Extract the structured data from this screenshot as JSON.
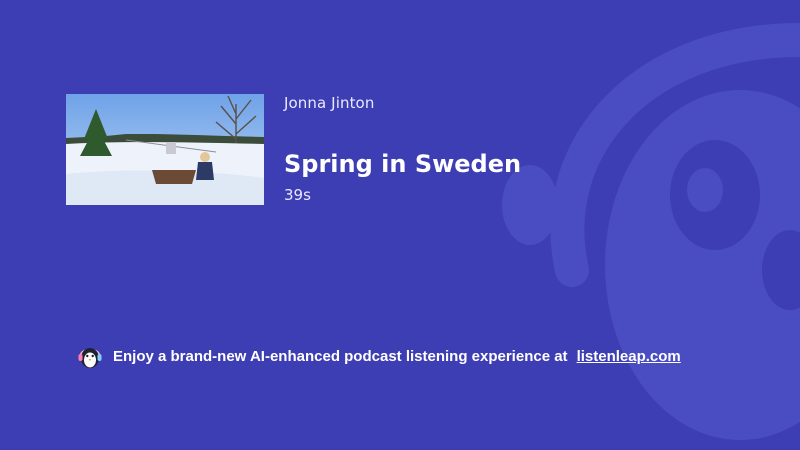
{
  "episode": {
    "author": "Jonna Jinton",
    "title": "Spring in Sweden",
    "duration": "39s",
    "thumbnail_icon": "snowy-landscape-thumbnail"
  },
  "promo": {
    "text": "Enjoy a brand-new AI-enhanced podcast listening experience at",
    "link_text": "listenleap.com",
    "icon": "penguin-headphones-icon"
  },
  "colors": {
    "background": "#3d3eb3",
    "watermark": "#4a4cc0"
  }
}
